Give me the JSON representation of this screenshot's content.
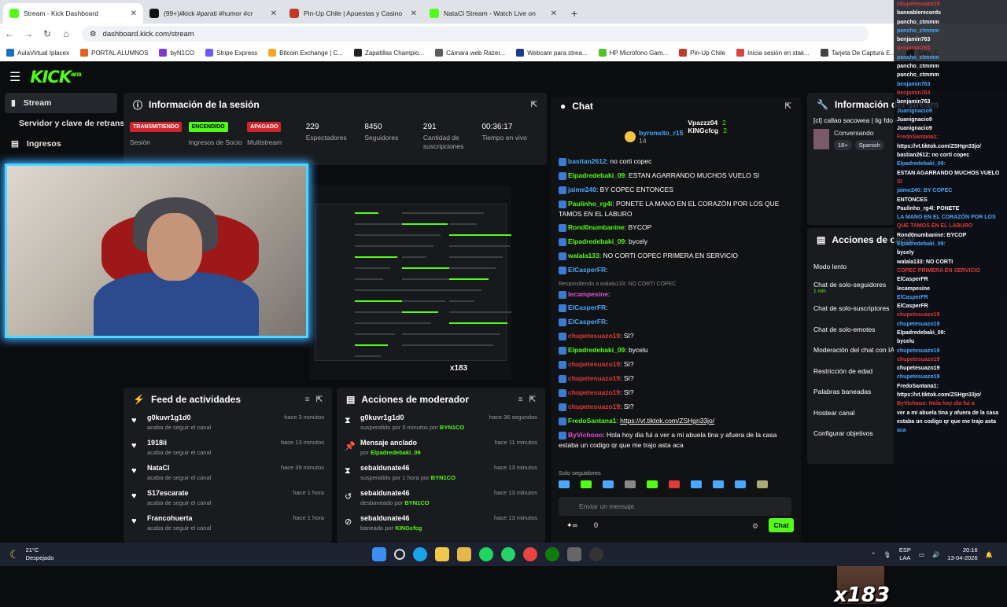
{
  "tabs": [
    {
      "title": "Stream - Kick Dashboard",
      "color": "#53fc18",
      "active": true
    },
    {
      "title": "(99+)#kick #parati #humor #cr",
      "color": "#111111"
    },
    {
      "title": "Pin-Up Chile | Apuestas y Casino",
      "color": "#c0392b"
    },
    {
      "title": "NataCl Stream - Watch Live on",
      "color": "#53fc18"
    }
  ],
  "url": "dashboard.kick.com/stream",
  "bookmarks": [
    "AulaVirtual Iplacex",
    "PORTAL ALUMNOS",
    "byN1CO",
    "Stripe Express",
    "Bitcoin Exchange | C...",
    "Zapatillas Champio...",
    "Cámara web Razer...",
    "Webcam para strea...",
    "HP Micrófono Gam...",
    "Pin-Up Chile",
    "Inicia sesión en stak...",
    "Tarjeta De Captura E...",
    "Sony C"
  ],
  "brand": {
    "logo": "KICK",
    "beta": "BETA"
  },
  "sidebar": [
    {
      "label": "Stream",
      "icon": "stream-icon"
    },
    {
      "label": "Servidor y clave de retransmisión",
      "icon": "server-icon"
    },
    {
      "label": "Ingresos",
      "icon": "income-icon"
    }
  ],
  "session": {
    "title": "Información de la sesión",
    "stats": [
      {
        "badge": "TRANSMITIENDO",
        "badge_color": "#d1232a",
        "label": "Sesión"
      },
      {
        "badge": "ENCENDIDO",
        "badge_color": "#53fc18",
        "label": "Ingresos de Socio"
      },
      {
        "badge": "APAGADO",
        "badge_color": "#d1232a",
        "label": "Multistream"
      },
      {
        "num": "229",
        "label": "Espectadores"
      },
      {
        "num": "8450",
        "label": "Seguidores"
      },
      {
        "num": "291",
        "label": "Cantidad de suscripciones"
      },
      {
        "num": "00:36:17",
        "label": "Tiempo en vivo"
      }
    ]
  },
  "feed": {
    "title": "Feed de actividades",
    "items": [
      {
        "name": "g0kuvr1g1d0",
        "sub": "acaba de seguir el canal",
        "time": "hace 3 minutos"
      },
      {
        "name": "1918ii",
        "sub": "acaba de seguir el canal",
        "time": "hace 13 minutos"
      },
      {
        "name": "NataCl",
        "sub": "acaba de seguir el canal",
        "time": "hace 39 minutos"
      },
      {
        "name": "S17escarate",
        "sub": "acaba de seguir el canal",
        "time": "hace 1 hora"
      },
      {
        "name": "Francohuerta",
        "sub": "acaba de seguir el canal",
        "time": "hace 1 hora"
      }
    ]
  },
  "mods": {
    "title": "Acciones de moderador",
    "items": [
      {
        "icon": "⧗",
        "name": "g0kuvr1g1d0",
        "sub": "suspendido por 5 minutos por",
        "by": "BYN1CO",
        "time": "hace 36 segundos"
      },
      {
        "icon": "📌",
        "name": "Mensaje anclado",
        "sub": "por",
        "by": "Elpadredebaki_09",
        "time": "hace 11 minutos"
      },
      {
        "icon": "⧗",
        "name": "sebaldunate46",
        "sub": "suspendido por 1 hora por",
        "by": "BYN1CO",
        "time": "hace 13 minutos"
      },
      {
        "icon": "↺",
        "name": "sebaldunate46",
        "sub": "desbaneado por",
        "by": "BYN1CO",
        "time": "hace 13 minutos"
      },
      {
        "icon": "⊘",
        "name": "sebaldunate46",
        "sub": "baneado por",
        "by": "KINGcfcg",
        "time": "hace 13 minutos"
      }
    ]
  },
  "chat": {
    "title": "Chat",
    "pinned": [
      {
        "user": "byronsito_r15",
        "count": "14"
      },
      {
        "user": "Vpazzz04",
        "count": "2"
      },
      {
        "user": "KINGcfcg",
        "count": "2"
      }
    ],
    "messages": [
      {
        "user": "bastian2612",
        "color": "#4aa8ff",
        "text": "no corti copec"
      },
      {
        "user": "Elpadredebaki_09",
        "color": "#53fc18",
        "text": "ESTAN AGARRANDO MUCHOS VUELO SI"
      },
      {
        "user": "jaime240",
        "color": "#4aa8ff",
        "text": "BY COPEC ENTONCES"
      },
      {
        "user": "Paulinho_rg4l",
        "color": "#53fc18",
        "text": "PONETE LA MANO EN EL CORAZÓN POR LOS QUE TAMOS EN EL LABURO"
      },
      {
        "user": "Rond0numbanine",
        "color": "#53fc18",
        "text": "BYCOP"
      },
      {
        "user": "Elpadredebaki_09",
        "color": "#53fc18",
        "text": "bycely"
      },
      {
        "user": "walala133",
        "color": "#53fc18",
        "text": "NO CORTI COPEC PRIMERA EN SERVICIO"
      },
      {
        "user": "ElCasperFR",
        "color": "#4aa8ff",
        "text": ""
      },
      {
        "user": "lecampesine",
        "color": "#e04fd7",
        "text": "",
        "reply": "Respondiendo a walala133: NO CORTI COPEC"
      },
      {
        "user": "ElCasperFR",
        "color": "#4aa8ff",
        "text": ""
      },
      {
        "user": "ElCasperFR",
        "color": "#4aa8ff",
        "text": ""
      },
      {
        "user": "chupetesuazo19",
        "color": "#e03a3a",
        "text": "SI?"
      },
      {
        "user": "Elpadredebaki_09",
        "color": "#53fc18",
        "text": "bycelu"
      },
      {
        "user": "chupetesuazo19",
        "color": "#e03a3a",
        "text": "SI?"
      },
      {
        "user": "chupetesuazo19",
        "color": "#e03a3a",
        "text": "SI?"
      },
      {
        "user": "chupetesuazo19",
        "color": "#e03a3a",
        "text": "SI?"
      },
      {
        "user": "chupetesuazo19",
        "color": "#e03a3a",
        "text": "SI?"
      },
      {
        "user": "FredoSantana1",
        "color": "#53fc18",
        "text": "https://vt.tiktok.com/ZSHgn33jo/"
      },
      {
        "user": "ByVichooo",
        "color": "#e04fd7",
        "text": "Hola hoy dia fui a ver a mi abuela tina y afuera de la casa estaba un codigo qr que me trajo asta aca"
      }
    ],
    "solo": "Solo seguidores",
    "placeholder": "Enviar un mensaje",
    "count": "0",
    "send": "Chat"
  },
  "info": {
    "title": "Información del stream",
    "stream_title": "[cl] callao sacowea | lig fdo es...",
    "category": "Conversando",
    "tags": [
      "18+",
      "Spanish"
    ]
  },
  "actions": {
    "title": "Acciones de canal",
    "items": [
      {
        "label": "Modo lento"
      },
      {
        "label": "Chat de solo-seguidores",
        "sub": "1 min"
      },
      {
        "label": "Chat de solo-suscriptores"
      },
      {
        "label": "Chat de solo-emotes"
      },
      {
        "label": "Moderación del chat con IA"
      },
      {
        "label": "Restricción de edad"
      },
      {
        "label": "Palabras baneadas"
      },
      {
        "label": "Hostear canal"
      },
      {
        "label": "Configurar objetivos"
      }
    ]
  },
  "overlay": [
    "chupetesuazo19",
    "baneablerecords",
    "pancho_ctmmm",
    "pancho_ctmmm",
    "benjamin763",
    "benjamin763",
    "pancho_ctmmm",
    "pancho_ctmmm",
    "pancho_ctmmm",
    "benjamin763",
    "benjamin763",
    "benjamin763",
    "Juanignacio9",
    "Juanignacio9",
    "Juanignacio9",
    "FredoSantana1:",
    "https://vt.tiktok.com/ZSHgn33jo/",
    "bastian2612: no corti copec",
    "Elpadredebaki_09:",
    "ESTAN AGARRANDO MUCHOS VUELO",
    "SI",
    "jaime240: BY COPEC",
    "ENTONCES",
    "Paulinho_rg4l: PONETE",
    "LA MANO EN EL CORAZÓN POR LOS",
    "QUE TAMOS EN EL LABURO",
    "Rond0numbanine: BYCOP",
    "Elpadredebaki_09:",
    "bycely",
    "walala133: NO CORTI",
    "COPEC PRIMERA EN SERVICIO",
    "ElCasperFR",
    "lecampesine",
    "ElCasperFR",
    "ElCasperFR",
    "chupetesuazo19",
    "chupetesuazo19",
    "Elpadredebaki_09:",
    "bycelu",
    "chupetesuazo19",
    "chupetesuazo19",
    "chupetesuazo19",
    "chupetesuazo19",
    "FredoSantana1:",
    "https://vt.tiktok.com/ZSHgn33jo/",
    "ByVichooo: Hola hoy dia fui a",
    "ver a mi abuela tina y afuera de la casa",
    "estaba un codigo qr que me trajo asta",
    "aca"
  ],
  "meme_label": "x183",
  "ss_label": "x183",
  "taskbar": {
    "temp": "21°C",
    "weather": "Despejado",
    "lang1": "ESP",
    "lang2": "LAA",
    "time": "20:16",
    "date": "13-04-2026"
  }
}
